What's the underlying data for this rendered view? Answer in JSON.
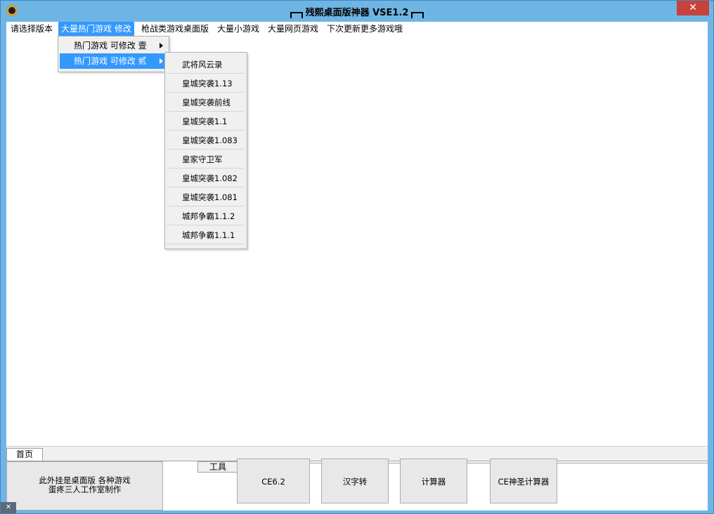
{
  "window": {
    "title": "残熙桌面版神器 VSE1.2",
    "close_glyph": "✕"
  },
  "menubar": {
    "items": [
      {
        "label": "请选择版本"
      },
      {
        "label": "大量热门游戏 修改"
      },
      {
        "label": "枪战类游戏桌面版"
      },
      {
        "label": "大量小游戏"
      },
      {
        "label": "大量网页游戏"
      },
      {
        "label": "下次更新更多游戏哦"
      }
    ]
  },
  "dropdown": {
    "items": [
      {
        "label": "热门游戏 可修改 壹"
      },
      {
        "label": "热门游戏 可修改 贰"
      }
    ]
  },
  "submenu": {
    "items": [
      {
        "label": "武将风云录"
      },
      {
        "label": "皇城突袭1.13"
      },
      {
        "label": "皇城突袭前线"
      },
      {
        "label": "皇城突袭1.1"
      },
      {
        "label": "皇城突袭1.083"
      },
      {
        "label": "皇家守卫军"
      },
      {
        "label": "皇城突袭1.082"
      },
      {
        "label": "皇城突袭1.081"
      },
      {
        "label": "城邦争霸1.1.2"
      },
      {
        "label": "城邦争霸1.1.1"
      }
    ]
  },
  "bottom": {
    "tab_home": "首页",
    "info_line1": "此外挂是桌面版 各种游戏",
    "info_line2": "蛋疼三人工作室制作",
    "group_label": "工具",
    "buttons": [
      {
        "label": "CE6.2"
      },
      {
        "label": "汉字转"
      },
      {
        "label": "计算器"
      },
      {
        "label": "CE神圣计算器"
      }
    ]
  },
  "corner_glyph": "✕"
}
